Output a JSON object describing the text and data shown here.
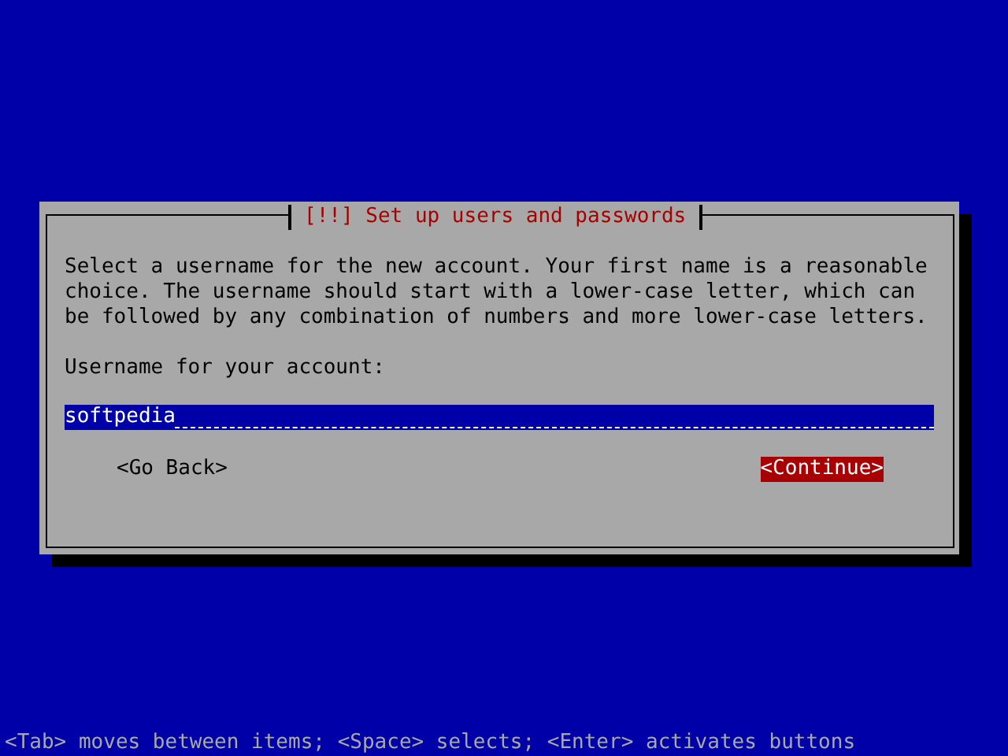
{
  "dialog": {
    "title": "[!!] Set up users and passwords",
    "description": "Select a username for the new account. Your first name is a reasonable choice. The username should start with a lower-case letter, which can be followed by any combination of numbers and more lower-case letters.",
    "field_label": "Username for your account:",
    "field_value": "softpedia",
    "buttons": [
      {
        "label": "<Go Back>",
        "selected": false
      },
      {
        "label": "<Continue>",
        "selected": true
      }
    ]
  },
  "help_line": "<Tab> moves between items; <Space> selects; <Enter> activates buttons"
}
